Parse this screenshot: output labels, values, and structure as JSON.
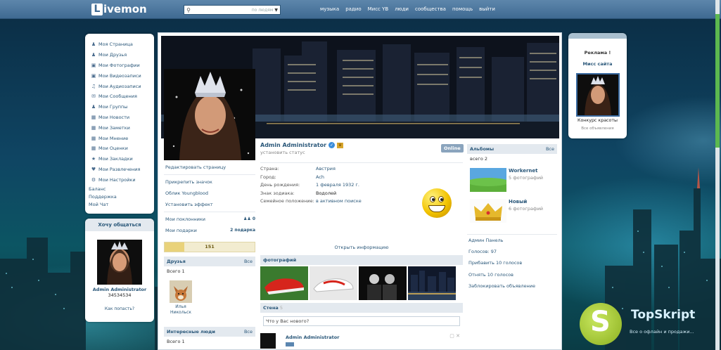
{
  "colors": {
    "topbar": "#4c78a0",
    "link": "#2b587a",
    "block_header": "#e3e9ef",
    "accent_green": "#5cb84f"
  },
  "topbar": {
    "logo_letter": "L",
    "logo_rest": "ivemon",
    "search": {
      "placeholder": "",
      "scope": "по людям"
    },
    "nav": [
      "музыка",
      "радио",
      "Мисс YB",
      "люди",
      "сообщества",
      "помощь",
      "выйти"
    ]
  },
  "sidebar": {
    "items": [
      {
        "label": "Моя Страница",
        "icon": "home-icon"
      },
      {
        "label": "Мои Друзья",
        "icon": "friends-icon"
      },
      {
        "label": "Мои Фотографии",
        "icon": "photo-icon"
      },
      {
        "label": "Мои Видеозаписи",
        "icon": "video-icon"
      },
      {
        "label": "Мои Аудиозаписи",
        "icon": "music-icon"
      },
      {
        "label": "Мои Сообщения",
        "icon": "message-icon"
      },
      {
        "label": "Мои Группы",
        "icon": "groups-icon"
      },
      {
        "label": "Мои Новости",
        "icon": "news-icon"
      },
      {
        "label": "Мои Заметки",
        "icon": "notes-icon"
      },
      {
        "label": "Мои Мнение",
        "icon": "opinion-icon"
      },
      {
        "label": "Мои Оценки",
        "icon": "rating-icon"
      },
      {
        "label": "Мои Закладки",
        "icon": "bookmark-icon"
      },
      {
        "label": "Мои Развлечения",
        "icon": "games-icon"
      },
      {
        "label": "Мои Настройки",
        "icon": "gear-icon"
      }
    ],
    "extra": [
      "Баланс",
      "Поддержка",
      "Мой Чат"
    ]
  },
  "want_box": {
    "title": "Хочу общаться",
    "name": "Admin Administrator",
    "number": "34534534",
    "how": "Как попасть?"
  },
  "profile": {
    "name": "Admin Administrator",
    "online": "Online",
    "status": "установить статус",
    "info": [
      {
        "key": "Страна:",
        "value": "Австрия"
      },
      {
        "key": "Город:",
        "value": "Ach"
      },
      {
        "key": "День рождения:",
        "value": "1 февраля 1932 г."
      },
      {
        "key": "Знак зодиака:",
        "value": "Водолей"
      },
      {
        "key": "Семейное положение:",
        "value": "в активном поиске"
      }
    ],
    "open_info": "Открыть информацию",
    "photos_title": "фотографий",
    "wall_title": "Стена",
    "wall_count": "5",
    "wall_input": "Что у Вас нового?",
    "post_author": "Admin Administrator"
  },
  "left_actions": {
    "links": [
      "Редактировать страницу",
      "Прикрепить значок",
      "Облик Youngblood",
      "Установить эффект"
    ],
    "fans_label": "Мои поклонники",
    "fans_count": "0",
    "gifts_label": "Мои подарки",
    "gifts_count": "2 подарка",
    "rating_value": "151",
    "rating_fill": 0.22
  },
  "friends": {
    "title": "Друзья",
    "all": "Все",
    "count": "Всего 1",
    "items": [
      {
        "name": "Илья Никольск"
      }
    ]
  },
  "interesting": {
    "title": "Интересные люди",
    "all": "Все",
    "count": "Всего 1"
  },
  "albums": {
    "title": "Альбомы",
    "all": "Все",
    "count": "всего 2",
    "items": [
      {
        "title": "Workernet",
        "sub": "5 фотографий"
      },
      {
        "title": "Новый",
        "sub": "6 фотографий"
      }
    ]
  },
  "admin_links": [
    "Админ Панель",
    "Голосов: 97",
    "Прибавить 10 голосов",
    "Отнять 10 голосов",
    "Заблокировать объявление"
  ],
  "ad": {
    "title": "Реклама !",
    "subtitle": "Мисс сайта",
    "caption": "Конкурс красоты",
    "all": "Все объявления"
  },
  "watermark": {
    "letter": "S",
    "title": "TopSkript",
    "subtitle": "Все о офлайн и продажи..."
  }
}
